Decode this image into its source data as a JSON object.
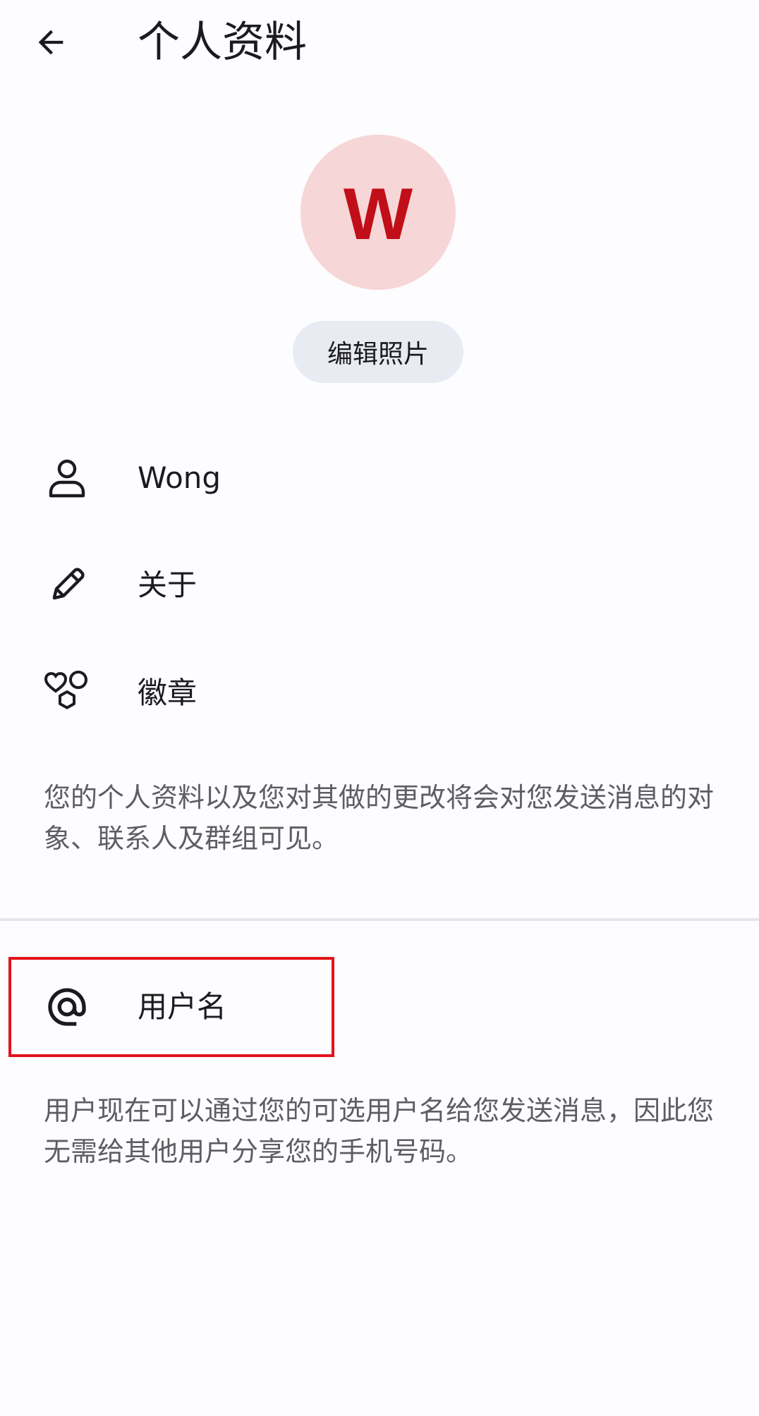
{
  "header": {
    "title": "个人资料",
    "back_icon": "arrow-left-icon"
  },
  "avatar": {
    "letter": "W",
    "bg_color": "#f7d6d7",
    "letter_color": "#c00f18"
  },
  "edit_photo": {
    "label": "编辑照片"
  },
  "profile_rows": [
    {
      "icon": "person-icon",
      "label": "Wong"
    },
    {
      "icon": "pencil-icon",
      "label": "关于"
    },
    {
      "icon": "badges-icon",
      "label": "徽章"
    }
  ],
  "profile_note": "您的个人资料以及您对其做的更改将会对您发送消息的对象、联系人及群组可见。",
  "username_row": {
    "icon": "at-sign-icon",
    "label": "用户名"
  },
  "username_note": "用户现在可以通过您的可选用户名给您发送消息，因此您无需给其他用户分享您的手机号码。",
  "colors": {
    "highlight_border": "#e3131a",
    "background": "#fdfcff",
    "secondary_text": "#5e5e62"
  }
}
